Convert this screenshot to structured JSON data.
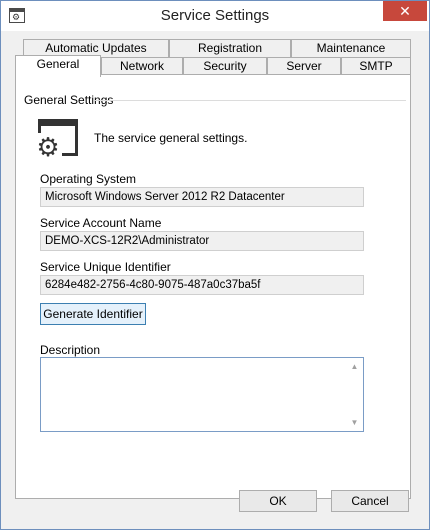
{
  "window": {
    "title": "Service Settings",
    "close_label": "✕"
  },
  "tabs_top": [
    "Automatic Updates",
    "Registration",
    "Maintenance"
  ],
  "tabs_bottom": [
    "General",
    "Network",
    "Security",
    "Server",
    "SMTP"
  ],
  "active_tab": "General",
  "group": {
    "label": "General Settings",
    "description": "The service general settings."
  },
  "fields": {
    "os_label": "Operating System",
    "os_value": "Microsoft Windows Server 2012 R2 Datacenter",
    "account_label": "Service Account Name",
    "account_value": "DEMO-XCS-12R2\\Administrator",
    "uid_label": "Service Unique Identifier",
    "uid_value": "6284e482-2756-4c80-9075-487a0c37ba5f",
    "description_label": "Description",
    "description_value": ""
  },
  "buttons": {
    "generate": "Generate Identifier",
    "ok": "OK",
    "cancel": "Cancel"
  },
  "icons": {
    "app": "window-icon",
    "settings": "settings-gear-icon"
  }
}
